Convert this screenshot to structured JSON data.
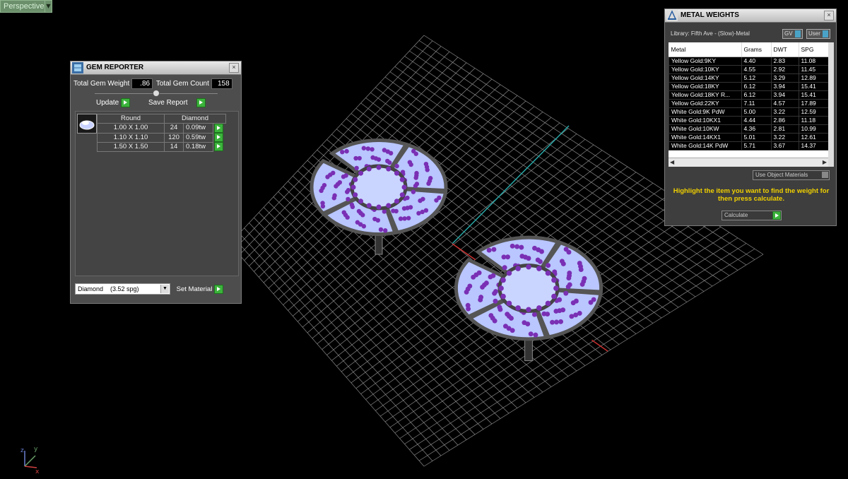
{
  "viewport": {
    "label": "Perspective",
    "axis_labels": [
      "z",
      "y",
      "x"
    ]
  },
  "gem_reporter": {
    "title": "GEM REPORTER",
    "total_weight_label": "Total Gem Weight",
    "total_weight_value": ".86",
    "total_count_label": "Total Gem Count",
    "total_count_value": "158",
    "update_label": "Update",
    "save_report_label": "Save Report",
    "table": {
      "headers": [
        "Round",
        "Diamond"
      ],
      "rows": [
        {
          "size": "1.00 X 1.00",
          "count": "24",
          "weight": "0.09tw"
        },
        {
          "size": "1.10 X 1.10",
          "count": "120",
          "weight": "0.59tw"
        },
        {
          "size": "1.50 X 1.50",
          "count": "14",
          "weight": "0.18tw"
        }
      ]
    },
    "material_select": "Diamond    (3.52 spg)",
    "set_material_label": "Set Material"
  },
  "metal_weights": {
    "title": "METAL WEIGHTS",
    "library": "Library: Fifth Ave - (Slow)-Metal",
    "toggle_gv": "GV",
    "toggle_user": "User",
    "columns": [
      "Metal",
      "Grams",
      "DWT",
      "SPG"
    ],
    "rows": [
      [
        "Yellow Gold:9KY",
        "4.40",
        "2.83",
        "11.08"
      ],
      [
        "Yellow Gold:10KY",
        "4.55",
        "2.92",
        "11.45"
      ],
      [
        "Yellow Gold:14KY",
        "5.12",
        "3.29",
        "12.89"
      ],
      [
        "Yellow Gold:18KY",
        "6.12",
        "3.94",
        "15.41"
      ],
      [
        "Yellow Gold:18KY R...",
        "6.12",
        "3.94",
        "15.41"
      ],
      [
        "Yellow Gold:22KY",
        "7.11",
        "4.57",
        "17.89"
      ],
      [
        "White Gold:9K PdW",
        "5.00",
        "3.22",
        "12.59"
      ],
      [
        "White Gold:10KX1",
        "4.44",
        "2.86",
        "11.18"
      ],
      [
        "White Gold:10KW",
        "4.36",
        "2.81",
        "10.99"
      ],
      [
        "White Gold:14KX1",
        "5.01",
        "3.22",
        "12.61"
      ],
      [
        "White Gold:14K PdW",
        "5.71",
        "3.67",
        "14.37"
      ]
    ],
    "use_object_materials": "Use Object Materials",
    "hint": "Highlight the item you want to find the weight for then press calculate.",
    "calculate_label": "Calculate"
  },
  "colors": {
    "grid": "#8a8a8a",
    "gem_fill": "#b9c6ff",
    "gem_dot": "#7a2fb4",
    "panel_bg": "#4d4d4d",
    "hint_text": "#f0d000"
  }
}
